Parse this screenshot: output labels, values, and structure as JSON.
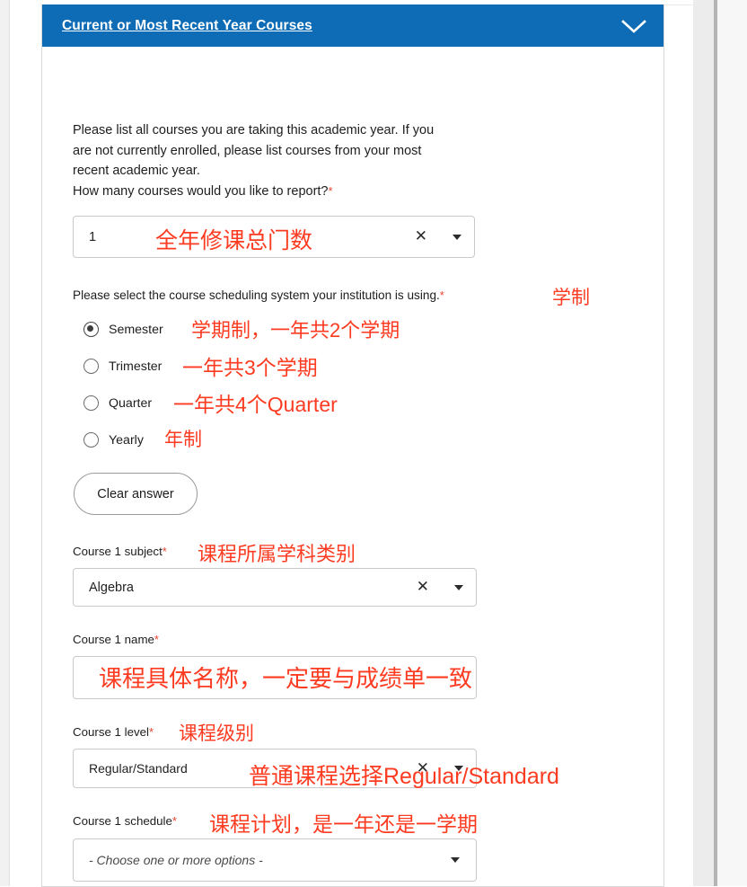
{
  "card": {
    "header": {
      "title": "Current or Most Recent Year Courses",
      "collapse_icon": "chevron-up-icon"
    },
    "accent_color": "#0d6cb5",
    "annotation_color": "#fc3b21"
  },
  "intro": {
    "line1": "Please list all courses you are taking this academic year. If you",
    "line2": "are not currently enrolled, please list courses from your most",
    "line3": "recent academic year.",
    "line4": "How many courses would you like to report?",
    "required_mark": "*"
  },
  "course_count": {
    "value": "1",
    "annotation": "全年修课总门数",
    "clear_icon": "close-icon",
    "caret_icon": "caret-down-icon"
  },
  "scheduling": {
    "question": "Please select the course scheduling system your institution is using.",
    "required_mark": "*",
    "annotation": "学制",
    "options": [
      {
        "label": "Semester",
        "annotation": "学期制，一年共2个学期",
        "selected": true
      },
      {
        "label": "Trimester",
        "annotation": "一年共3个学期",
        "selected": false
      },
      {
        "label": "Quarter",
        "annotation": "一年共4个Quarter",
        "selected": false
      },
      {
        "label": "Yearly",
        "annotation": "年制",
        "selected": false
      }
    ],
    "clear_answer_label": "Clear answer"
  },
  "course1_subject": {
    "label": "Course 1 subject",
    "required_mark": "*",
    "annotation": "课程所属学科类别",
    "value": "Algebra",
    "clear_icon": "close-icon",
    "caret_icon": "caret-down-icon"
  },
  "course1_name": {
    "label": "Course 1 name",
    "required_mark": "*",
    "annotation": "课程具体名称，一定要与成绩单一致",
    "value": ""
  },
  "course1_level": {
    "label": "Course 1 level",
    "required_mark": "*",
    "annotation_label": "课程级别",
    "annotation_field": "普通课程选择Regular/Standard",
    "value": "Regular/Standard",
    "clear_icon": "close-icon",
    "caret_icon": "caret-down-icon"
  },
  "course1_schedule": {
    "label": "Course 1 schedule",
    "required_mark": "*",
    "annotation": "课程计划，是一年还是一学期",
    "placeholder": "- Choose one or more options -",
    "caret_icon": "caret-down-icon"
  }
}
